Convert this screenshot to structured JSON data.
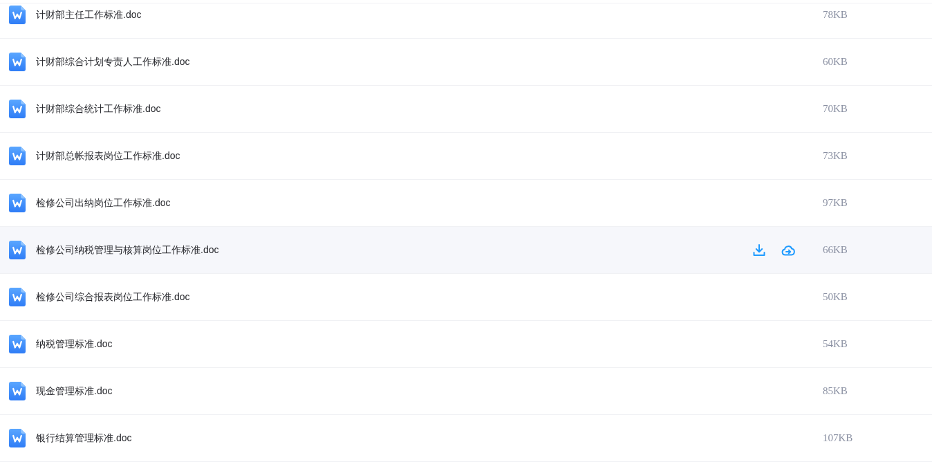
{
  "files": [
    {
      "name": "计财部主任工作标准.doc",
      "size": "78KB",
      "hovered": false
    },
    {
      "name": "计财部综合计划专责人工作标准.doc",
      "size": "60KB",
      "hovered": false
    },
    {
      "name": "计财部综合统计工作标准.doc",
      "size": "70KB",
      "hovered": false
    },
    {
      "name": "计财部总帐报表岗位工作标准.doc",
      "size": "73KB",
      "hovered": false
    },
    {
      "name": "检修公司出纳岗位工作标准.doc",
      "size": "97KB",
      "hovered": false
    },
    {
      "name": "检修公司纳税管理与核算岗位工作标准.doc",
      "size": "66KB",
      "hovered": true
    },
    {
      "name": "检修公司综合报表岗位工作标准.doc",
      "size": "50KB",
      "hovered": false
    },
    {
      "name": "纳税管理标准.doc",
      "size": "54KB",
      "hovered": false
    },
    {
      "name": "现金管理标准.doc",
      "size": "85KB",
      "hovered": false
    },
    {
      "name": "银行结算管理标准.doc",
      "size": "107KB",
      "hovered": false
    }
  ]
}
